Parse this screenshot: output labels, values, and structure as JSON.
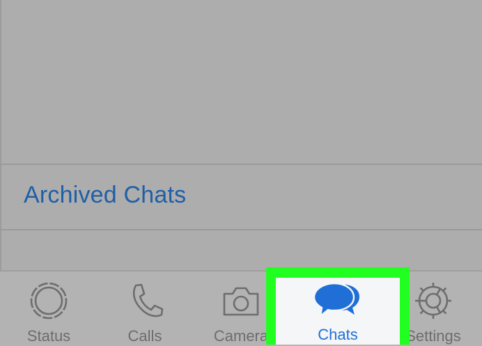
{
  "archived": {
    "label": "Archived Chats"
  },
  "tabbar": {
    "tabs": [
      {
        "label": "Status",
        "icon": "status-ring-icon"
      },
      {
        "label": "Calls",
        "icon": "phone-icon"
      },
      {
        "label": "Camera",
        "icon": "camera-icon"
      },
      {
        "label": "Chats",
        "icon": "chat-bubbles-icon",
        "selected": true
      },
      {
        "label": "Settings",
        "icon": "gear-icon"
      }
    ]
  },
  "colors": {
    "link": "#1e5fa8",
    "active": "#1f6fd6",
    "inactive": "#6d6d6d",
    "highlight": "#21ff21",
    "dim_background": "#adadad"
  }
}
